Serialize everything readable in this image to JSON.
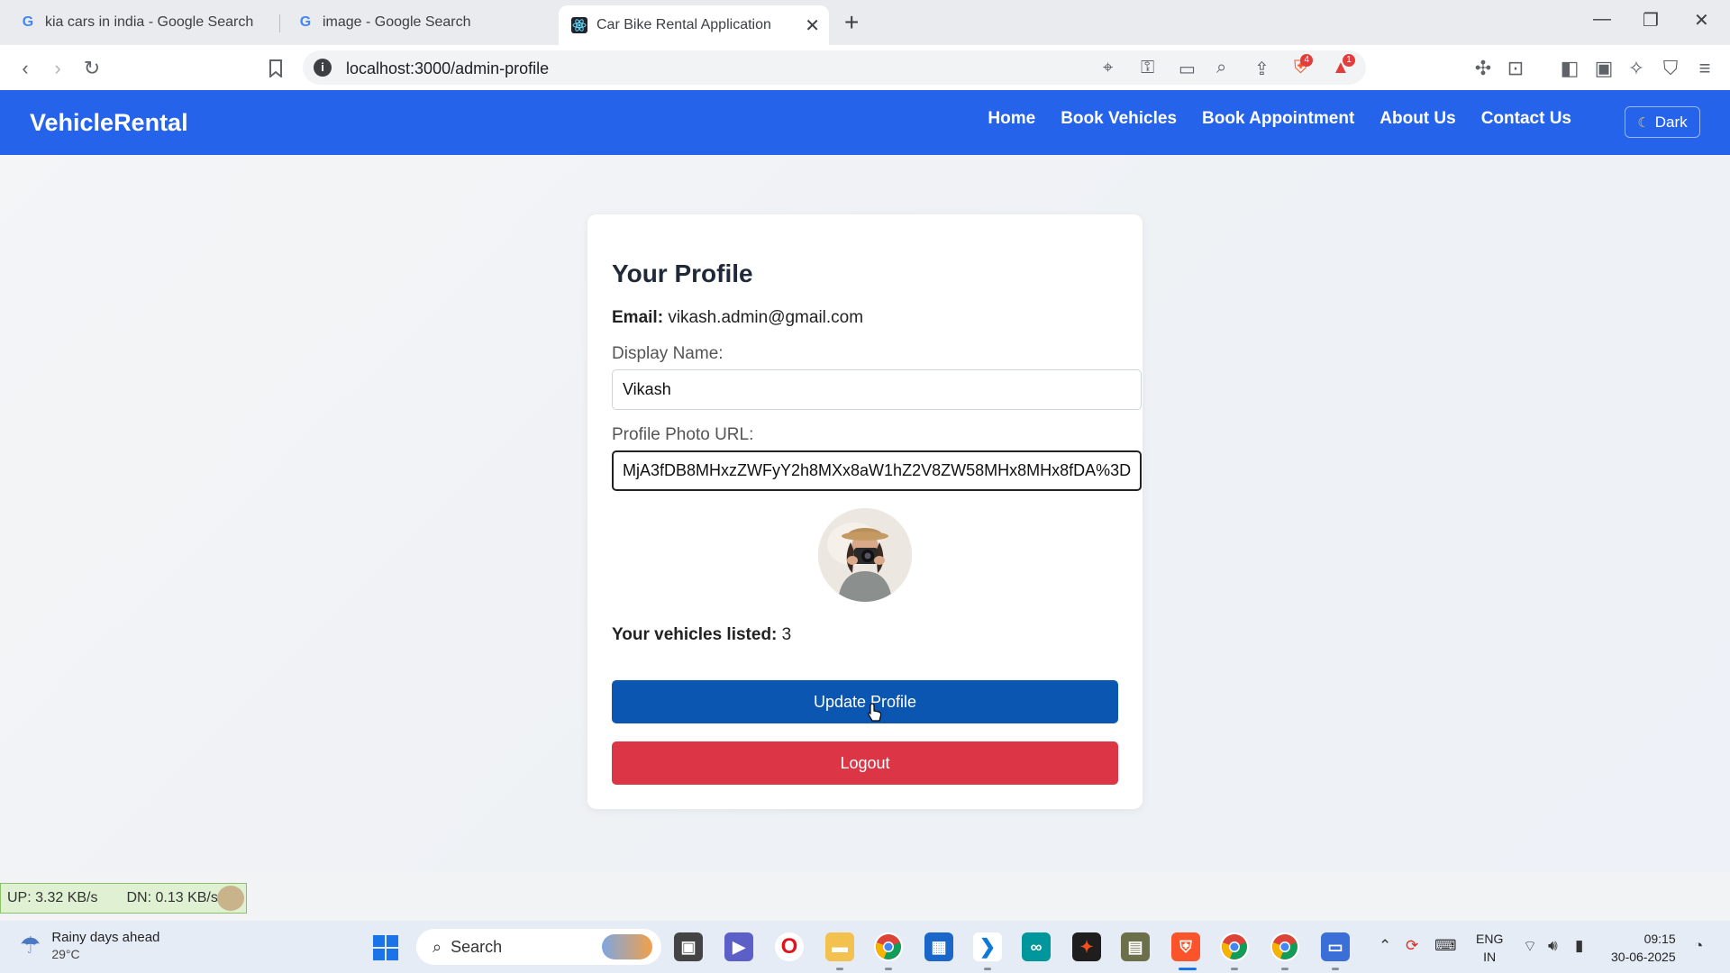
{
  "browser": {
    "tabs": [
      {
        "title": "kia cars in india - Google Search",
        "active": false
      },
      {
        "title": "image - Google Search",
        "active": false
      },
      {
        "title": "Car Bike Rental Application",
        "active": true
      }
    ],
    "address": "localhost:3000/admin-profile",
    "shield_badge": "4",
    "alert_badge": "1"
  },
  "navbar": {
    "brand": "VehicleRental",
    "links": [
      "Home",
      "Book Vehicles",
      "Book Appointment",
      "About Us",
      "Contact Us"
    ],
    "dark_toggle": "Dark"
  },
  "profile": {
    "heading": "Your Profile",
    "email_label": "Email:",
    "email_value": "vikash.admin@gmail.com",
    "display_name_label": "Display Name:",
    "display_name_value": "Vikash",
    "photo_url_label": "Profile Photo URL:",
    "photo_url_value": "MjA3fDB8MHxzZWFyY2h8MXx8aW1hZ2V8ZW58MHx8MHx8fDA%3D",
    "vehicles_label": "Your vehicles listed:",
    "vehicles_count": "3",
    "update_button": "Update Profile",
    "logout_button": "Logout"
  },
  "netspeed": {
    "up": "UP: 3.32 KB/s",
    "down": "DN: 0.13 KB/s"
  },
  "taskbar": {
    "weather_title": "Rainy days ahead",
    "weather_temp": "29°C",
    "search_placeholder": "Search",
    "lang_line1": "ENG",
    "lang_line2": "IN",
    "time": "09:15",
    "date": "30-06-2025"
  },
  "colors": {
    "navbar": "#2563eb",
    "update_button": "#0b56b0",
    "logout_button": "#dc3545"
  }
}
